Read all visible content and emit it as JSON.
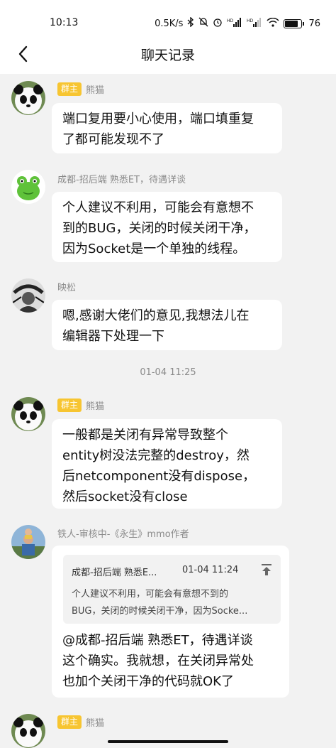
{
  "status_bar": {
    "time": "10:13",
    "network_speed": "0.5K/s",
    "battery_percent": "76",
    "icons": [
      "bluetooth-icon",
      "mute-icon",
      "alarm-icon",
      "hd-signal-icon",
      "hd-signal-icon",
      "wifi-icon",
      "battery-icon"
    ]
  },
  "header": {
    "title": "聊天记录",
    "back_icon": "back-arrow-icon"
  },
  "messages": [
    {
      "sender": "熊猫",
      "badge": "群主",
      "avatar": "panda-avatar",
      "lines": [
        "端口复用要小心使用，端口填重复",
        "了都可能发现不了"
      ]
    },
    {
      "sender": "成都-招后端 熟悉ET，待遇详谈",
      "avatar": "frog-avatar",
      "lines": [
        "个人建议不利用，可能会有意想不",
        "到的BUG，关闭的时候关闭干净，",
        "因为Socket是一个单独的线程。"
      ]
    },
    {
      "sender": "映松",
      "avatar": "sketch-avatar",
      "lines": [
        "嗯,感谢大佬们的意见,我想法儿在",
        "编辑器下处理一下"
      ]
    },
    {
      "sender": "熊猫",
      "badge": "群主",
      "avatar": "panda-avatar",
      "lines": [
        "一般都是关闭有异常导致整个",
        "entity树没法完整的destroy，然",
        "后netcomponent没有dispose，",
        "然后socket没有close"
      ]
    },
    {
      "sender": "铁人-审核中-《永生》mmo作者",
      "avatar": "family-photo-avatar",
      "quote": {
        "sender": "成都-招后端 熟悉E...",
        "time": "01-04 11:24",
        "lines": [
          "个人建议不利用，可能会有意想不到的",
          "BUG，关闭的时候关闭干净，因为Socke..."
        ]
      },
      "lines": [
        "@成都-招后端 熟悉ET，待遇详谈",
        "这个确实。我就想，在关闭异常处",
        "也加个关闭干净的代码就OK了"
      ]
    },
    {
      "sender": "熊猫",
      "badge": "群主",
      "avatar": "panda-avatar",
      "lines": []
    }
  ],
  "timestamp_divider": "01-04 11:25",
  "colors": {
    "badge": "#f7c531",
    "background": "#f2f2f2",
    "bubble": "#ffffff"
  }
}
